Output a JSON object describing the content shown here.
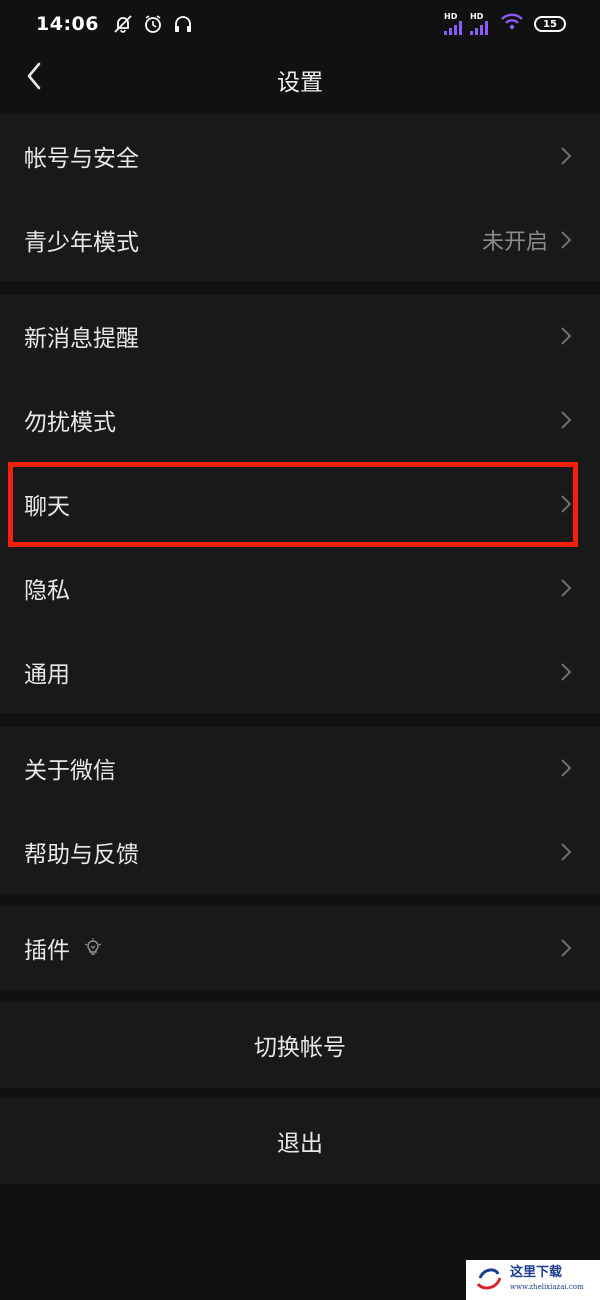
{
  "status_bar": {
    "time": "14:06",
    "signal1_label": "HD",
    "signal2_label": "HD",
    "battery": "15",
    "icons": [
      "bell-off-icon",
      "alarm-icon",
      "headset-icon",
      "signal-icon",
      "wifi-icon",
      "battery-icon"
    ]
  },
  "nav": {
    "title": "设置",
    "back_icon": "chevron-left-icon"
  },
  "group1": {
    "account_security": "帐号与安全",
    "youth_mode": "青少年模式",
    "youth_mode_value": "未开启"
  },
  "group2": {
    "new_message": "新消息提醒",
    "do_not_disturb": "勿扰模式",
    "chat": "聊天",
    "privacy": "隐私",
    "general": "通用"
  },
  "group3": {
    "about": "关于微信",
    "help": "帮助与反馈"
  },
  "group4": {
    "plugins": "插件"
  },
  "actions": {
    "switch_account": "切换帐号",
    "logout": "退出"
  },
  "watermark": {
    "text": "这里下载",
    "sub": "www.zhelixiazai.com"
  },
  "colors": {
    "background": "#111111",
    "row_background": "#191919",
    "highlight": "#f2210e",
    "signal": "#8a5cf5"
  }
}
